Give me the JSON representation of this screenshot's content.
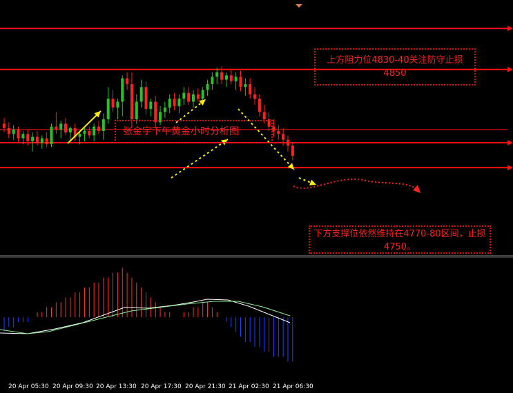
{
  "chart_data": {
    "type": "candlestick",
    "annotations": {
      "title": "张金宇下午黄金小时分析图",
      "resistance": "上方阻力位4830-40关注防守止损4850",
      "support": "下方支撑位依然维持在4770-80区间，止损4750。"
    },
    "x_tick_labels": [
      "20 Apr 05:30",
      "20 Apr 09:30",
      "20 Apr 13:30",
      "20 Apr 17:30",
      "20 Apr 21:30",
      "21 Apr 02:30",
      "21 Apr 06:30"
    ],
    "ylim": [
      4710,
      4870
    ],
    "horizontal_levels": [
      4860,
      4832,
      4782,
      4791,
      4765
    ],
    "candles": [
      {
        "o": 4795,
        "h": 4799,
        "l": 4789,
        "c": 4792
      },
      {
        "o": 4792,
        "h": 4796,
        "l": 4785,
        "c": 4788
      },
      {
        "o": 4788,
        "h": 4794,
        "l": 4784,
        "c": 4791
      },
      {
        "o": 4791,
        "h": 4793,
        "l": 4782,
        "c": 4785
      },
      {
        "o": 4785,
        "h": 4790,
        "l": 4781,
        "c": 4788
      },
      {
        "o": 4788,
        "h": 4791,
        "l": 4780,
        "c": 4783
      },
      {
        "o": 4783,
        "h": 4789,
        "l": 4776,
        "c": 4786
      },
      {
        "o": 4786,
        "h": 4790,
        "l": 4780,
        "c": 4782
      },
      {
        "o": 4782,
        "h": 4787,
        "l": 4778,
        "c": 4785
      },
      {
        "o": 4785,
        "h": 4789,
        "l": 4779,
        "c": 4781
      },
      {
        "o": 4781,
        "h": 4795,
        "l": 4779,
        "c": 4793
      },
      {
        "o": 4793,
        "h": 4803,
        "l": 4788,
        "c": 4791
      },
      {
        "o": 4791,
        "h": 4797,
        "l": 4785,
        "c": 4795
      },
      {
        "o": 4795,
        "h": 4799,
        "l": 4787,
        "c": 4789
      },
      {
        "o": 4789,
        "h": 4793,
        "l": 4784,
        "c": 4792
      },
      {
        "o": 4792,
        "h": 4795,
        "l": 4783,
        "c": 4786
      },
      {
        "o": 4786,
        "h": 4790,
        "l": 4781,
        "c": 4788
      },
      {
        "o": 4788,
        "h": 4792,
        "l": 4783,
        "c": 4790
      },
      {
        "o": 4790,
        "h": 4793,
        "l": 4785,
        "c": 4787
      },
      {
        "o": 4787,
        "h": 4795,
        "l": 4783,
        "c": 4793
      },
      {
        "o": 4793,
        "h": 4797,
        "l": 4788,
        "c": 4790
      },
      {
        "o": 4790,
        "h": 4802,
        "l": 4784,
        "c": 4798
      },
      {
        "o": 4798,
        "h": 4820,
        "l": 4795,
        "c": 4812
      },
      {
        "o": 4812,
        "h": 4818,
        "l": 4803,
        "c": 4806
      },
      {
        "o": 4806,
        "h": 4812,
        "l": 4798,
        "c": 4810
      },
      {
        "o": 4810,
        "h": 4828,
        "l": 4800,
        "c": 4826
      },
      {
        "o": 4826,
        "h": 4830,
        "l": 4818,
        "c": 4822
      },
      {
        "o": 4822,
        "h": 4830,
        "l": 4792,
        "c": 4798
      },
      {
        "o": 4798,
        "h": 4815,
        "l": 4795,
        "c": 4810
      },
      {
        "o": 4810,
        "h": 4825,
        "l": 4806,
        "c": 4820
      },
      {
        "o": 4820,
        "h": 4824,
        "l": 4801,
        "c": 4805
      },
      {
        "o": 4805,
        "h": 4812,
        "l": 4800,
        "c": 4810
      },
      {
        "o": 4810,
        "h": 4814,
        "l": 4792,
        "c": 4796
      },
      {
        "o": 4796,
        "h": 4807,
        "l": 4794,
        "c": 4803
      },
      {
        "o": 4803,
        "h": 4810,
        "l": 4799,
        "c": 4806
      },
      {
        "o": 4806,
        "h": 4815,
        "l": 4802,
        "c": 4812
      },
      {
        "o": 4812,
        "h": 4816,
        "l": 4804,
        "c": 4807
      },
      {
        "o": 4807,
        "h": 4815,
        "l": 4802,
        "c": 4812
      },
      {
        "o": 4812,
        "h": 4820,
        "l": 4808,
        "c": 4816
      },
      {
        "o": 4816,
        "h": 4820,
        "l": 4808,
        "c": 4810
      },
      {
        "o": 4810,
        "h": 4818,
        "l": 4806,
        "c": 4815
      },
      {
        "o": 4815,
        "h": 4819,
        "l": 4810,
        "c": 4812
      },
      {
        "o": 4812,
        "h": 4820,
        "l": 4808,
        "c": 4818
      },
      {
        "o": 4818,
        "h": 4825,
        "l": 4814,
        "c": 4822
      },
      {
        "o": 4822,
        "h": 4830,
        "l": 4818,
        "c": 4827
      },
      {
        "o": 4827,
        "h": 4833,
        "l": 4822,
        "c": 4830
      },
      {
        "o": 4830,
        "h": 4834,
        "l": 4822,
        "c": 4825
      },
      {
        "o": 4825,
        "h": 4830,
        "l": 4820,
        "c": 4828
      },
      {
        "o": 4828,
        "h": 4832,
        "l": 4822,
        "c": 4824
      },
      {
        "o": 4824,
        "h": 4830,
        "l": 4818,
        "c": 4827
      },
      {
        "o": 4827,
        "h": 4831,
        "l": 4817,
        "c": 4820
      },
      {
        "o": 4820,
        "h": 4826,
        "l": 4814,
        "c": 4822
      },
      {
        "o": 4822,
        "h": 4826,
        "l": 4812,
        "c": 4815
      },
      {
        "o": 4815,
        "h": 4820,
        "l": 4808,
        "c": 4812
      },
      {
        "o": 4812,
        "h": 4815,
        "l": 4800,
        "c": 4803
      },
      {
        "o": 4803,
        "h": 4808,
        "l": 4795,
        "c": 4798
      },
      {
        "o": 4798,
        "h": 4803,
        "l": 4790,
        "c": 4793
      },
      {
        "o": 4793,
        "h": 4798,
        "l": 4786,
        "c": 4790
      },
      {
        "o": 4790,
        "h": 4794,
        "l": 4784,
        "c": 4788
      },
      {
        "o": 4788,
        "h": 4792,
        "l": 4780,
        "c": 4784
      },
      {
        "o": 4784,
        "h": 4787,
        "l": 4776,
        "c": 4780
      },
      {
        "o": 4780,
        "h": 4782,
        "l": 4770,
        "c": 4773
      }
    ],
    "macd": {
      "hist": [
        -3,
        -2,
        -2,
        -1,
        -1,
        -1,
        0,
        1,
        1,
        2,
        2,
        3,
        3,
        4,
        4,
        5,
        5,
        6,
        6,
        7,
        7,
        8,
        8,
        9,
        9,
        10,
        9,
        8,
        7,
        6,
        5,
        4,
        3,
        2,
        1,
        1,
        0,
        0,
        1,
        1,
        2,
        2,
        3,
        3,
        2,
        1,
        0,
        -1,
        -2,
        -3,
        -4,
        -5,
        -5,
        -6,
        -6,
        -7,
        -7,
        -8,
        -8,
        -8,
        -9,
        -9
      ],
      "ylim": [
        -12,
        12
      ]
    },
    "colors": {
      "bull": "#27c227",
      "bear": "#ff2020",
      "level": "#ff1010",
      "arrow": "#ffee00",
      "macd_line": "#ffffff",
      "signal_line": "#8ef08e"
    }
  }
}
